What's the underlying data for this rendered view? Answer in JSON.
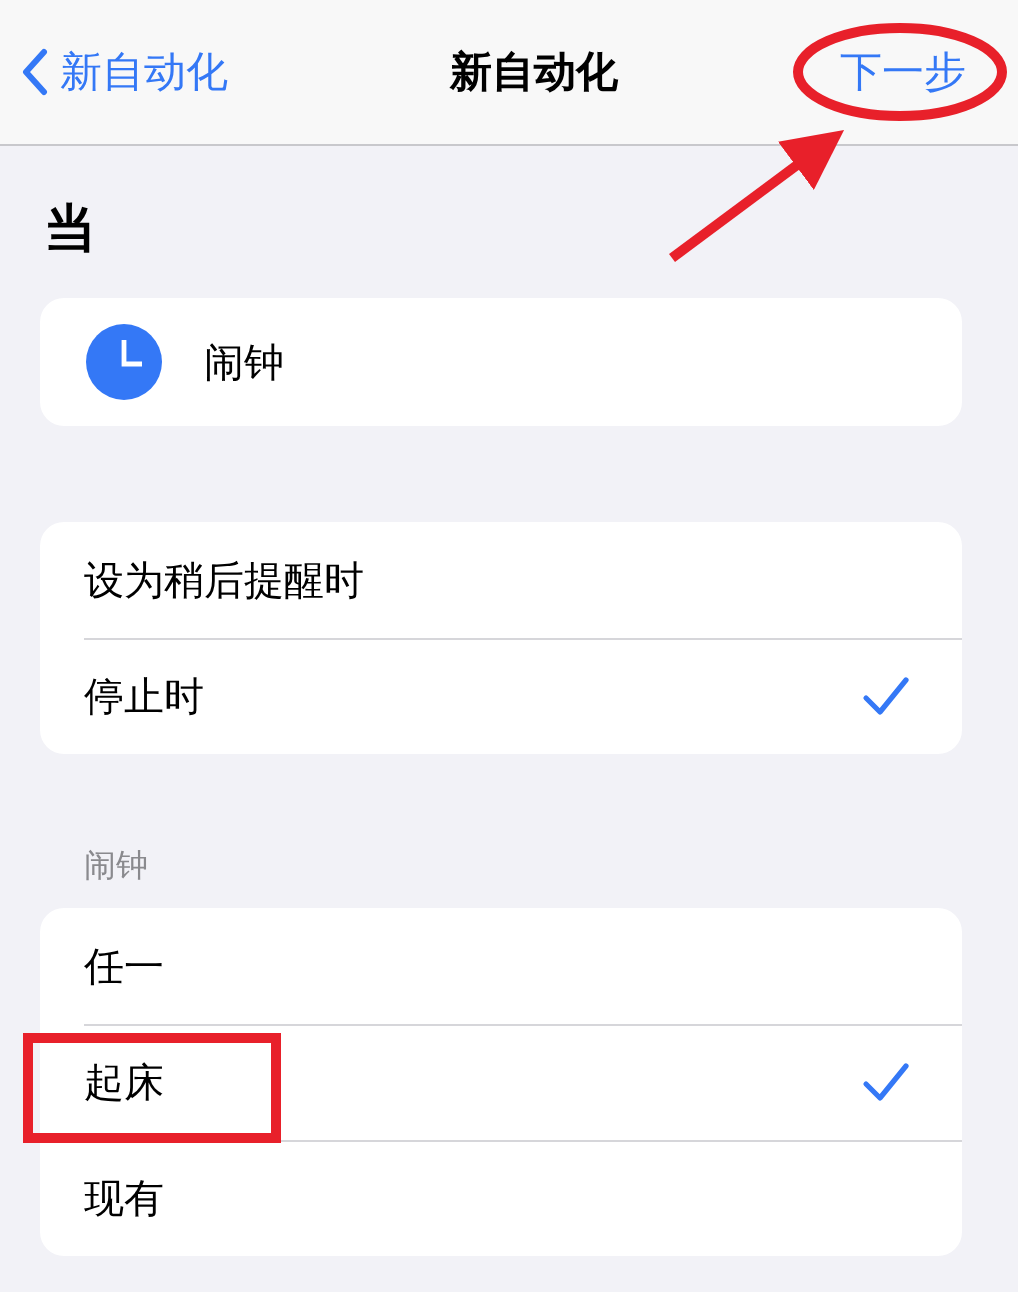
{
  "nav": {
    "back_label": "新自动化",
    "title": "新自动化",
    "next_label": "下一步"
  },
  "heading": "当",
  "trigger": {
    "label": "闹钟"
  },
  "options": [
    {
      "label": "设为稍后提醒时",
      "selected": false
    },
    {
      "label": "停止时",
      "selected": true
    }
  ],
  "alarm_section": {
    "label": "闹钟",
    "items": [
      {
        "label": "任一",
        "selected": false
      },
      {
        "label": "起床",
        "selected": true
      },
      {
        "label": "现有",
        "selected": false
      }
    ]
  },
  "annotations": [
    {
      "kind": "ellipse"
    },
    {
      "kind": "arrow"
    },
    {
      "kind": "rectangle"
    }
  ]
}
